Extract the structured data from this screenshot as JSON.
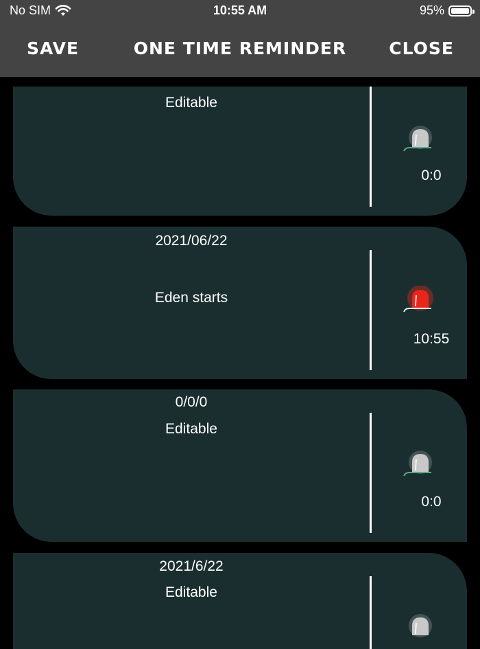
{
  "status_bar": {
    "carrier": "No SIM",
    "time": "10:55 AM",
    "battery": "95%"
  },
  "nav": {
    "save": "SAVE",
    "title": "ONE TIME REMINDER",
    "close": "CLOSE"
  },
  "reminders": [
    {
      "date": "",
      "text": "Editable",
      "time": "0:0",
      "active": false
    },
    {
      "date": "2021/06/22",
      "text": "Eden starts",
      "time": "10:55",
      "active": true
    },
    {
      "date": "0/0/0",
      "text": "Editable",
      "time": "0:0",
      "active": false
    },
    {
      "date": "2021/6/22",
      "text": "Editable",
      "time": "",
      "active": false
    }
  ],
  "colors": {
    "header_bg": "#444444",
    "card_bg": "#1a2e30",
    "bell_inactive": "#c8c8c8",
    "bell_active": "#e8261c"
  }
}
